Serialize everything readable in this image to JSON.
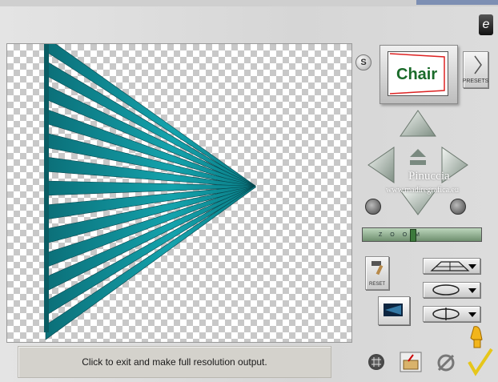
{
  "status": {
    "message": "Click to exit and make full resolution output."
  },
  "thumbnail": {
    "text": "Chair"
  },
  "buttons": {
    "presets_label": "PRESETS",
    "reset_label": "RESET",
    "s_label": "S"
  },
  "watermark": {
    "name": "Pinuccia",
    "url": "www.madiregrafica.eu"
  },
  "zoom": {
    "label": "ZOOM",
    "level": 0.4
  },
  "colors": {
    "teal": "#0e8f98",
    "teal_dark": "#06525a",
    "checker": "#c8c8c8",
    "status_bg": "#d4d2cc"
  },
  "icons": {
    "logo": "e",
    "ok": "checkmark-icon",
    "cancel": "cancel-icon",
    "hand": "pointing-hand-icon",
    "grid": "grid-icon",
    "folder": "folder-icon"
  }
}
